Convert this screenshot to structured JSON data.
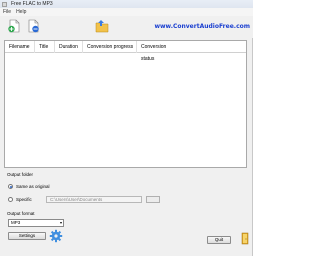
{
  "window": {
    "title": "Free FLAC to MP3"
  },
  "menu": {
    "items": [
      "File",
      "Help"
    ]
  },
  "toolbar": {
    "website": "www.ConvertAudioFree.com"
  },
  "table": {
    "columns": [
      "Filename",
      "Title",
      "Duration",
      "Conversion progress",
      "Conversion status"
    ],
    "rows": []
  },
  "output_folder": {
    "label": "Output folder",
    "option_same": "Same as original",
    "option_specific": "Specific",
    "selected": "Same as original",
    "path_value": "C:\\Users\\User\\Documents"
  },
  "output_format": {
    "label": "Output format",
    "selected": "MP3"
  },
  "buttons": {
    "settings": "Settings",
    "quit": "Quit"
  },
  "colors": {
    "link": "#1a3fd0",
    "accent": "#2a5fbf"
  }
}
